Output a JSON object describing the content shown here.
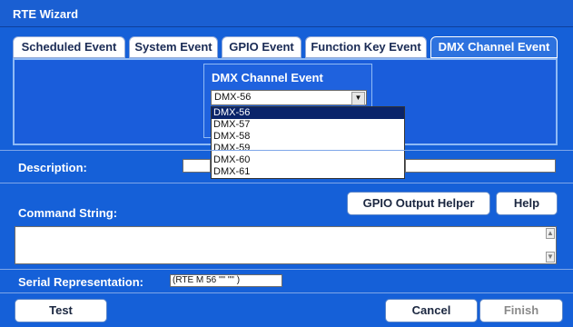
{
  "window": {
    "title": "RTE Wizard"
  },
  "tabs": [
    {
      "label": "Scheduled Event"
    },
    {
      "label": "System Event"
    },
    {
      "label": "GPIO Event"
    },
    {
      "label": "Function Key Event"
    },
    {
      "label": "DMX Channel Event"
    }
  ],
  "dmx_dialog": {
    "title": "DMX Channel Event",
    "selected": "DMX-56",
    "options": [
      "DMX-56",
      "DMX-57",
      "DMX-58",
      "DMX-59",
      "DMX-60",
      "DMX-61"
    ]
  },
  "form": {
    "description_label": "Description:",
    "command_label": "Command String:",
    "gpio_helper_label": "GPIO Output Helper",
    "help_label": "Help",
    "serial_label": "Serial Representation:",
    "serial_value": "(RTE M 56 \"\" \"\" )"
  },
  "footer": {
    "test_label": "Test",
    "cancel_label": "Cancel",
    "finish_label": "Finish"
  },
  "colors": {
    "background": "#1560d8",
    "active_tab": "#2d72df",
    "selected_item": "#0a246a"
  }
}
